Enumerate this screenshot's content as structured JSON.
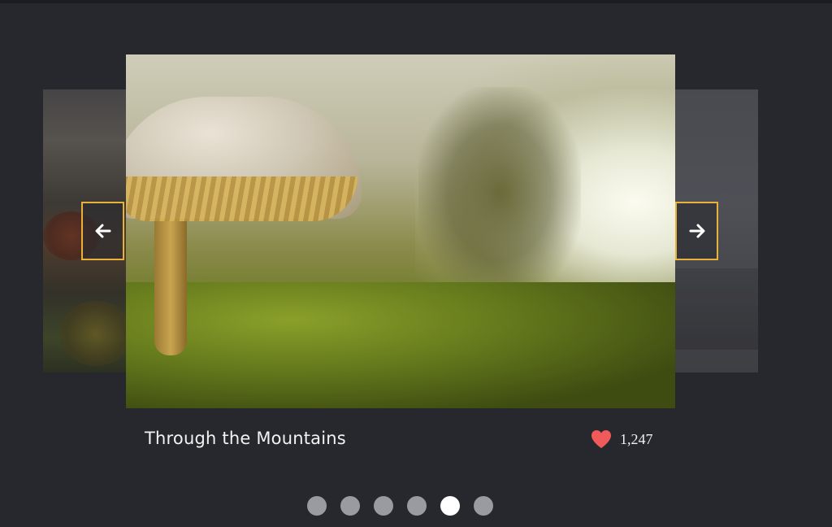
{
  "slide": {
    "title": "Through the Mountains",
    "likes": "1,247"
  },
  "nav": {
    "prev_icon": "arrow-left-icon",
    "next_icon": "arrow-right-icon"
  },
  "pagination": {
    "total": 6,
    "active_index": 4
  },
  "colors": {
    "background": "#27282d",
    "nav_border": "#e8b23a",
    "heart": "#f05a5a",
    "dot": "#9a9ba0",
    "dot_active": "#ffffff",
    "text": "#f2f2f2"
  }
}
